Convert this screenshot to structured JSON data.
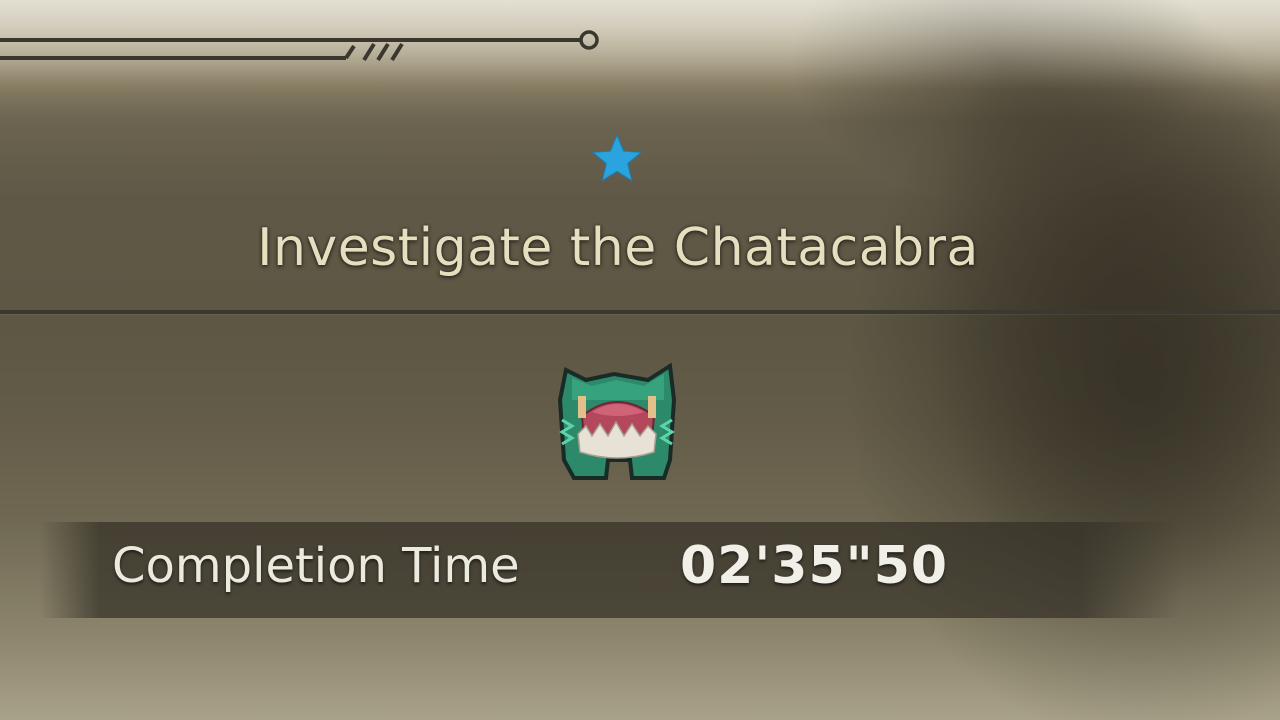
{
  "quest": {
    "title": "Investigate the Chatacabra",
    "rank_icon": "star-icon",
    "rank_color": "#2aa3de",
    "monster_icon": "chatacabra-monster-icon"
  },
  "result": {
    "label": "Completion Time",
    "value": "02'35\"50"
  },
  "colors": {
    "title_text": "#e6dfbf",
    "result_text": "#f1efe7",
    "divider": "#3b382f"
  }
}
